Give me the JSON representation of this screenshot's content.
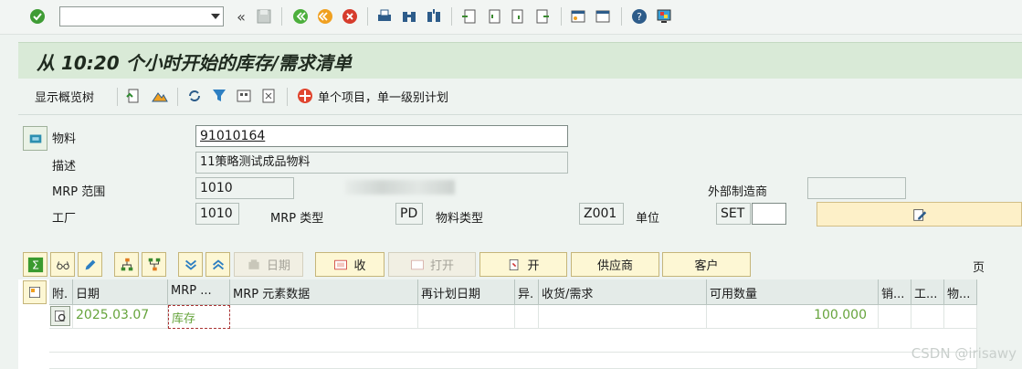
{
  "title": "从 10:20 个小时开始的库存/需求清单",
  "app_toolbar": {
    "show_overview": "显示概览树",
    "single_item": "单个项目，单一级别计划"
  },
  "form": {
    "material_label": "物料",
    "material_value": "91010164",
    "description_label": "描述",
    "description_value": "11策略测试成品物料",
    "mrp_area_label": "MRP 范围",
    "mrp_area_value": "1010",
    "ext_manufacturer_label": "外部制造商",
    "plant_label": "工厂",
    "plant_value": "1010",
    "mrp_type_label": "MRP 类型",
    "mrp_type_value": "PD",
    "material_type_label": "物料类型",
    "material_type_value": "Z001",
    "unit_label": "单位",
    "unit_value": "SET"
  },
  "buttons": {
    "date": "日期",
    "receive": "收",
    "open_disabled": "打开",
    "open": "开",
    "supplier": "供应商",
    "customer": "客户",
    "page": "页"
  },
  "table": {
    "headers": [
      "附.",
      "日期",
      "MRP ...",
      "MRP 元素数据",
      "再计划日期",
      "异.",
      "收货/需求",
      "可用数量",
      "销...",
      "工...",
      "物..."
    ],
    "rows": [
      {
        "date": "2025.03.07",
        "mrp_element": "库存",
        "available_qty": "100.000"
      }
    ]
  },
  "watermark": "CSDN @irisawy",
  "colors": {
    "accent_green": "#66a43c",
    "title_bg": "#d9ead7",
    "button_bg": "#fdf7d4"
  }
}
